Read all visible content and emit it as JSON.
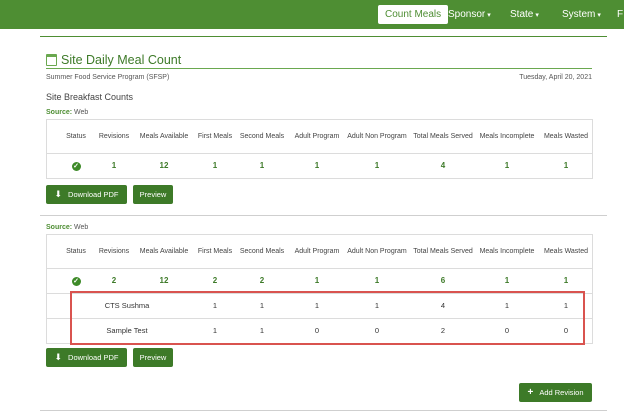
{
  "nav": {
    "items": [
      {
        "label": "Count Meals",
        "active": true
      },
      {
        "label": "Sponsor",
        "caret": "▾"
      },
      {
        "label": "State",
        "caret": "▾"
      },
      {
        "label": "System",
        "caret": "▾"
      },
      {
        "label": "F"
      }
    ]
  },
  "page": {
    "title": "Site Daily Meal Count",
    "program": "Summer Food Service Program (SFSP)",
    "date": "Tuesday, April 20, 2021",
    "section_title": "Site Breakfast Counts"
  },
  "columns": [
    "Status",
    "Revisions",
    "Meals Available",
    "First Meals",
    "Second Meals",
    "Adult Program",
    "Adult Non Program",
    "Total Meals Served",
    "Meals Incomplete",
    "Meals Wasted"
  ],
  "table1": {
    "source_label": "Source:",
    "source_value": "Web",
    "totals": {
      "revisions": "1",
      "meals_available": "12",
      "first_meals": "1",
      "second_meals": "1",
      "adult_program": "1",
      "adult_non_program": "1",
      "total_served": "4",
      "incomplete": "1",
      "wasted": "1"
    },
    "status_icon": "check-circle-icon"
  },
  "table2": {
    "source_label": "Source:",
    "source_value": "Web",
    "totals": {
      "revisions": "2",
      "meals_available": "12",
      "first_meals": "2",
      "second_meals": "2",
      "adult_program": "1",
      "adult_non_program": "1",
      "total_served": "6",
      "incomplete": "1",
      "wasted": "1"
    },
    "status_icon": "check-circle-icon",
    "details": [
      {
        "name": "CTS Sushma",
        "first_meals": "1",
        "second_meals": "1",
        "adult_program": "1",
        "adult_non_program": "1",
        "total_served": "4",
        "incomplete": "1",
        "wasted": "1"
      },
      {
        "name": "Sample Test",
        "first_meals": "1",
        "second_meals": "1",
        "adult_program": "0",
        "adult_non_program": "0",
        "total_served": "2",
        "incomplete": "0",
        "wasted": "0"
      }
    ]
  },
  "buttons": {
    "download_pdf": "Download PDF",
    "preview": "Preview",
    "add_revision": "Add Revision"
  },
  "icons": {
    "download": "download-icon",
    "add": "plus-icon",
    "calendar": "calendar-icon"
  },
  "colors": {
    "brand_green": "#4e8e33",
    "button_green": "#3d7a28",
    "highlight_red": "#d9534f"
  }
}
